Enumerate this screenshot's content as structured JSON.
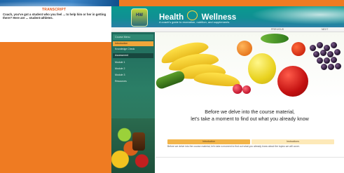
{
  "background": {
    "color": "#ef7b22"
  },
  "back_window": {
    "title": "TRANSCRIPT",
    "text": "Coach, you've got a student who you feel ... to help him or her in getting there? Here are ... student-athletes."
  },
  "front_window": {
    "seal_text": "HW",
    "title_part1": "Health",
    "title_part2": "Wellness",
    "subtitle": "A coach's guide to recreation, nutrition, and supplements",
    "toolbar": {
      "left": "PREVIOUS",
      "right": "NEXT"
    },
    "sidebar": {
      "heading": "Course Menu",
      "items": [
        {
          "label": "Introduction",
          "state": "active"
        },
        {
          "label": "Knowledge Check",
          "state": "normal"
        },
        {
          "label": "Assessment",
          "state": "dark"
        },
        {
          "label": "Module 1",
          "state": "normal"
        },
        {
          "label": "Module 2",
          "state": "normal"
        },
        {
          "label": "Module 3",
          "state": "normal"
        },
        {
          "label": "Resources",
          "state": "normal"
        }
      ]
    },
    "prompt": {
      "line1": "Before we delve into the course material,",
      "line2": "let's take a moment to find out what you already know"
    },
    "tabs": [
      {
        "label": "Introduction"
      },
      {
        "label": "Instructions"
      }
    ],
    "tab_body": "Before we delve into the course material, let's take a moment to find out what you already know about the topics we will cover."
  }
}
